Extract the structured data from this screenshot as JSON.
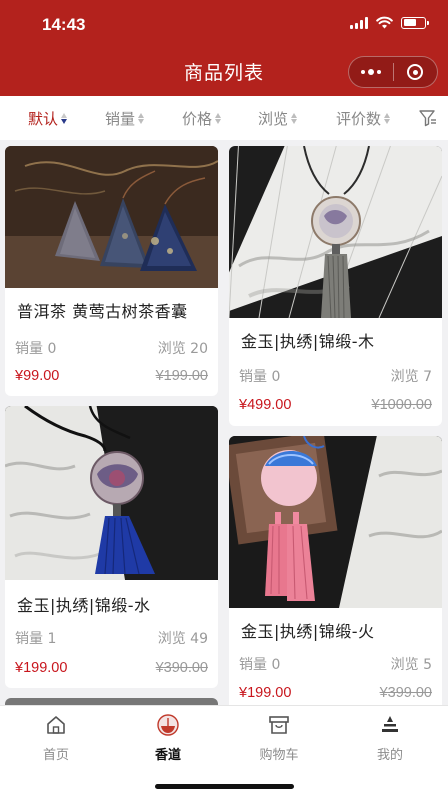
{
  "status_bar": {
    "time": "14:43"
  },
  "nav": {
    "title": "商品列表"
  },
  "sort": {
    "items": [
      {
        "label": "默认"
      },
      {
        "label": "销量"
      },
      {
        "label": "价格"
      },
      {
        "label": "浏览"
      },
      {
        "label": "评价数"
      }
    ]
  },
  "products": [
    {
      "name": "普洱茶 黄莺古树茶香囊",
      "sales_label": "销量 0",
      "views_label": "浏览 20",
      "price": "¥99.00",
      "original_price": "¥199.00"
    },
    {
      "name": "金玉|执绣|锦缎-木",
      "sales_label": "销量 0",
      "views_label": "浏览 7",
      "price": "¥499.00",
      "original_price": "¥1000.00"
    },
    {
      "name": "金玉|执绣|锦缎-水",
      "sales_label": "销量 1",
      "views_label": "浏览 49",
      "price": "¥199.00",
      "original_price": "¥390.00"
    },
    {
      "name": "金玉|执绣|锦缎-火",
      "sales_label": "销量 0",
      "views_label": "浏览 5",
      "price": "¥199.00",
      "original_price": "¥399.00"
    }
  ],
  "tabbar": {
    "items": [
      {
        "label": "首页",
        "icon": "home-icon"
      },
      {
        "label": "香道",
        "icon": "incense-icon"
      },
      {
        "label": "购物车",
        "icon": "cart-icon"
      },
      {
        "label": "我的",
        "icon": "profile-icon"
      }
    ],
    "active": "香道"
  },
  "colors": {
    "brand": "#b3221d",
    "price": "#c8161d"
  }
}
